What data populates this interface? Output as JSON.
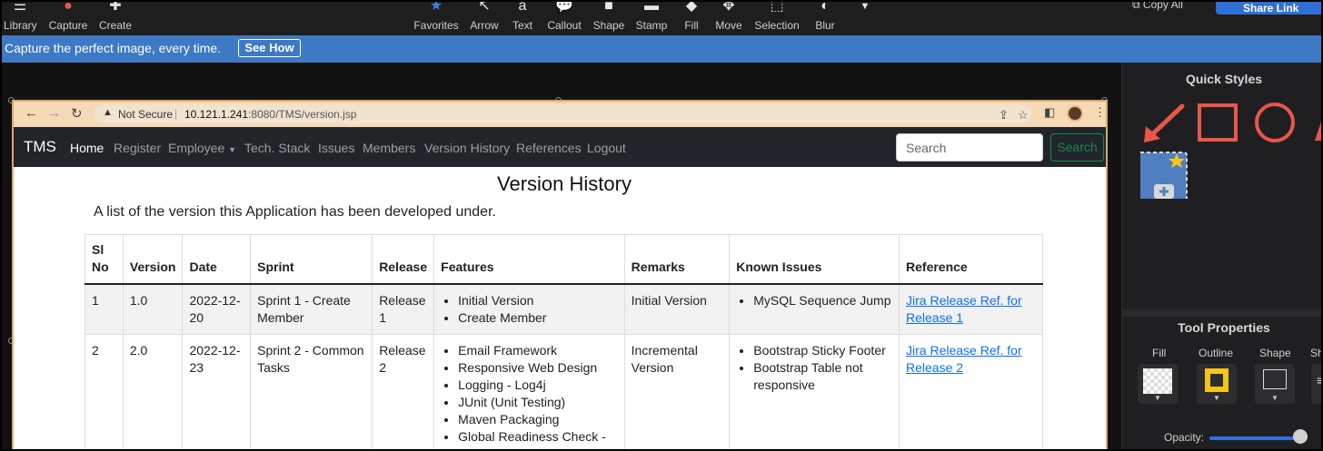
{
  "toolbar": {
    "left_items": [
      {
        "label": "Library",
        "icon": "menu-icon"
      },
      {
        "label": "Capture",
        "icon": "record-icon"
      },
      {
        "label": "Create",
        "icon": "plus-icon"
      }
    ],
    "tools": [
      {
        "label": "Favorites",
        "icon": "star-icon"
      },
      {
        "label": "Arrow",
        "icon": "arrow-icon"
      },
      {
        "label": "Text",
        "icon": "text-icon"
      },
      {
        "label": "Callout",
        "icon": "callout-icon"
      },
      {
        "label": "Shape",
        "icon": "shape-icon"
      },
      {
        "label": "Stamp",
        "icon": "stamp-icon"
      },
      {
        "label": "Fill",
        "icon": "fill-icon"
      },
      {
        "label": "Move",
        "icon": "move-icon"
      },
      {
        "label": "Selection",
        "icon": "selection-icon"
      },
      {
        "label": "Blur",
        "icon": "blur-icon"
      }
    ],
    "copy_all": "Copy All",
    "share_link": "Share Link"
  },
  "banner": {
    "text": "Capture the perfect image, every time.",
    "button": "See How"
  },
  "browser": {
    "security": "Not Secure",
    "url_host": "10.121.1.241",
    "url_path": ":8080/TMS/version.jsp"
  },
  "navbar": {
    "brand": "TMS",
    "links": [
      "Home",
      "Register",
      "Employee",
      "Tech. Stack",
      "Issues",
      "Members",
      "Version History",
      "References",
      "Logout"
    ],
    "search_placeholder": "Search",
    "search_button": "Search"
  },
  "page": {
    "title": "Version History",
    "subtitle": "A list of the version this Application has been developed under.",
    "columns": [
      "Sl No",
      "Version",
      "Date",
      "Sprint",
      "Release",
      "Features",
      "Remarks",
      "Known Issues",
      "Reference"
    ],
    "rows": [
      {
        "sl": "1",
        "version": "1.0",
        "date": "2022-12-20",
        "sprint": "Sprint 1 - Create Member",
        "release": "Release 1",
        "features": [
          "Initial Version",
          "Create Member"
        ],
        "remarks": "Initial Version",
        "issues": [
          "MySQL Sequence Jump"
        ],
        "reference": "Jira Release Ref. for Release 1"
      },
      {
        "sl": "2",
        "version": "2.0",
        "date": "2022-12-23",
        "sprint": "Sprint 2 - Common Tasks",
        "release": "Release 2",
        "features": [
          "Email Framework",
          "Responsive Web Design",
          "Logging - Log4j",
          "JUnit (Unit Testing)",
          "Maven Packaging",
          "Global Readiness Check -"
        ],
        "remarks": "Incremental Version",
        "issues": [
          "Bootstrap Sticky Footer",
          "Bootstrap Table not responsive"
        ],
        "reference": "Jira Release Ref. for Release 2"
      }
    ]
  },
  "panel": {
    "quick_styles_title": "Quick Styles",
    "tool_properties_title": "Tool Properties",
    "props": [
      "Fill",
      "Outline",
      "Shape",
      "Sh"
    ],
    "opacity_label": "Opacity:",
    "opacity_value": 0.95,
    "accent_color": "#e8574a",
    "highlight_color": "#f5c518"
  }
}
